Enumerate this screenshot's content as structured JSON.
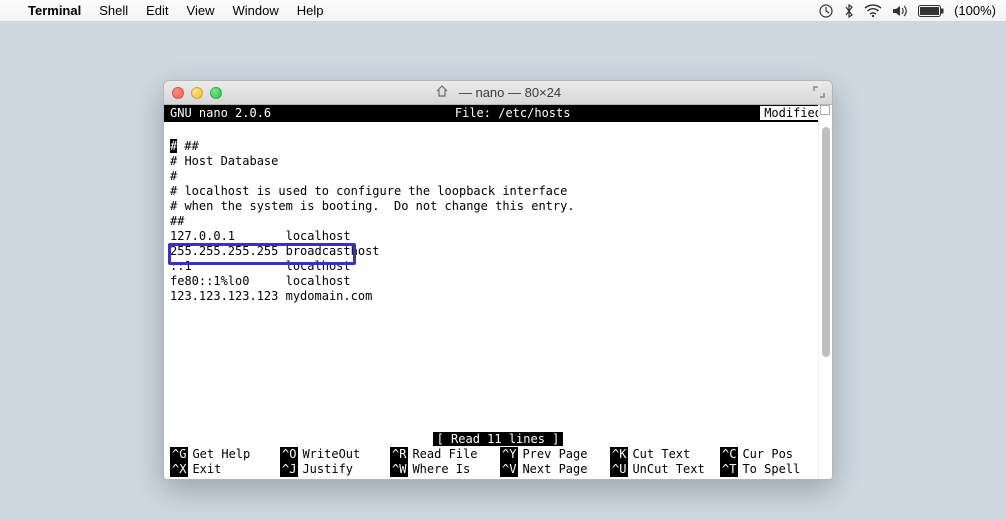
{
  "menubar": {
    "app": "Terminal",
    "items": [
      "Shell",
      "Edit",
      "View",
      "Window",
      "Help"
    ],
    "battery": "(100%)"
  },
  "window": {
    "title": "— nano — 80×24"
  },
  "nano": {
    "version": "GNU nano 2.0.6",
    "file_label": "File: /etc/hosts",
    "modified": "Modified",
    "status": "[ Read 11 lines ]",
    "lines": [
      " ##",
      "# Host Database",
      "#",
      "# localhost is used to configure the loopback interface",
      "# when the system is booting.  Do not change this entry.",
      "##",
      "127.0.0.1       localhost",
      "255.255.255.255 broadcasthost",
      "::1             localhost",
      "fe80::1%lo0     localhost",
      "123.123.123.123 mydomain.com"
    ],
    "help": [
      {
        "key": "^G",
        "label": "Get Help"
      },
      {
        "key": "^O",
        "label": "WriteOut"
      },
      {
        "key": "^R",
        "label": "Read File"
      },
      {
        "key": "^Y",
        "label": "Prev Page"
      },
      {
        "key": "^K",
        "label": "Cut Text"
      },
      {
        "key": "^C",
        "label": "Cur Pos"
      },
      {
        "key": "^X",
        "label": "Exit"
      },
      {
        "key": "^J",
        "label": "Justify"
      },
      {
        "key": "^W",
        "label": "Where Is"
      },
      {
        "key": "^V",
        "label": "Next Page"
      },
      {
        "key": "^U",
        "label": "UnCut Text"
      },
      {
        "key": "^T",
        "label": "To Spell"
      }
    ]
  }
}
